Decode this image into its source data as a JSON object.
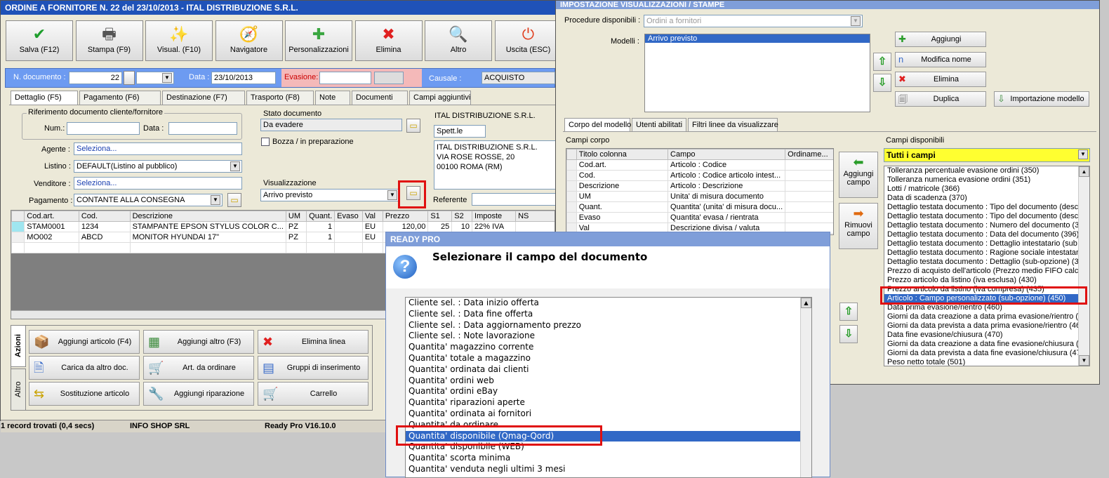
{
  "main_window": {
    "title": "ORDINE A FORNITORE N. 22 del 23/10/2013 - ITAL DISTRIBUZIONE S.R.L.",
    "toolbar": [
      {
        "label": "Salva (F12)",
        "icon": "check-icon",
        "glyph": "✔",
        "color": "#1e9e2c"
      },
      {
        "label": "Stampa (F9)",
        "icon": "printer-icon",
        "glyph": "🖶",
        "color": "#555555"
      },
      {
        "label": "Visual. (F10)",
        "icon": "magic-wand-icon",
        "glyph": "✨",
        "color": "#b88a00"
      },
      {
        "label": "Navigatore",
        "icon": "navigator-icon",
        "glyph": "🧭",
        "color": "#5560b0"
      },
      {
        "label": "Personalizzazioni",
        "icon": "puzzle-icon",
        "glyph": "✚",
        "color": "#3aa640"
      },
      {
        "label": "Elimina",
        "icon": "delete-x-icon",
        "glyph": "✖",
        "color": "#e02020"
      },
      {
        "label": "Altro",
        "icon": "magnifier-icon",
        "glyph": "🔍",
        "color": "#2b6bcb"
      },
      {
        "label": "Uscita (ESC)",
        "icon": "power-icon",
        "glyph": "⏻",
        "color": "#e04020"
      }
    ],
    "header": {
      "n_documento_label": "N. documento :",
      "n_documento": "22",
      "data_label": "Data :",
      "data": "23/10/2013",
      "evasione_label": "Evasione:",
      "evasione": "",
      "causale_label": "Causale :",
      "causale": "ACQUISTO"
    },
    "tabs": [
      "Dettaglio (F5)",
      "Pagamento (F6)",
      "Destinazione (F7)",
      "Trasporto (F8)",
      "Note",
      "Documenti",
      "Campi aggiuntivi"
    ],
    "rif": {
      "title": "Riferimento documento cliente/fornitore",
      "num_label": "Num.:",
      "data_label": "Data :"
    },
    "agente": {
      "label": "Agente :",
      "value": "Seleziona..."
    },
    "listino": {
      "label": "Listino :",
      "value": "DEFAULT(Listino al pubblico)"
    },
    "venditore": {
      "label": "Venditore :",
      "value": "Seleziona..."
    },
    "pagamento": {
      "label": "Pagamento :",
      "value": "CONTANTE ALLA CONSEGNA"
    },
    "stato": {
      "title": "Stato documento",
      "value": "Da evadere",
      "bozza": "Bozza / in preparazione"
    },
    "visualizzazione": {
      "title": "Visualizzazione",
      "value": "Arrivo previsto"
    },
    "fornitore": {
      "name": "ITAL DISTRIBUZIONE S.R.L.",
      "spett": "Spett.le",
      "address": [
        "ITAL DISTRIBUZIONE S.R.L.",
        "VIA ROSE ROSSE, 20",
        "00100 ROMA (RM)"
      ],
      "referente_label": "Referente"
    },
    "grid": {
      "columns": [
        "Cod.art.",
        "Cod.",
        "Descrizione",
        "UM",
        "Quant.",
        "Evaso",
        "Val",
        "Prezzo",
        "S1",
        "S2",
        "Imposte",
        "NS"
      ],
      "rows": [
        [
          "STAM0001",
          "1234",
          "STAMPANTE EPSON STYLUS COLOR C...",
          "PZ",
          "1",
          "",
          "EU",
          "120,00",
          "25",
          "10",
          "22% IVA",
          ""
        ],
        [
          "MO002",
          "ABCD",
          "MONITOR HYUNDAI 17\"",
          "PZ",
          "1",
          "",
          "EU",
          "",
          "",
          "",
          "",
          ""
        ]
      ]
    },
    "actions_tabs": [
      "Azioni",
      "Altro"
    ],
    "actions": [
      {
        "label": "Aggiungi articolo (F4)",
        "icon": "add-article-icon",
        "glyph": "📦"
      },
      {
        "label": "Aggiungi altro (F3)",
        "icon": "add-other-icon",
        "glyph": "▦"
      },
      {
        "label": "Elimina linea",
        "icon": "delete-line-icon",
        "glyph": "✖"
      },
      {
        "label": "Carica da altro doc.",
        "icon": "load-doc-icon",
        "glyph": "🗎"
      },
      {
        "label": "Art. da ordinare",
        "icon": "order-article-icon",
        "glyph": "🛒"
      },
      {
        "label": "Gruppi di inserimento",
        "icon": "groups-icon",
        "glyph": "▤"
      },
      {
        "label": "Sostituzione articolo",
        "icon": "replace-article-icon",
        "glyph": "⇆"
      },
      {
        "label": "Aggiungi riparazione",
        "icon": "wrench-icon",
        "glyph": "🔧"
      },
      {
        "label": "Carrello",
        "icon": "cart-icon",
        "glyph": "🛒"
      }
    ],
    "status_bar": {
      "records": "1 record trovati (0,4 secs)",
      "company": "INFO SHOP SRL",
      "version": "Ready Pro V16.10.0"
    }
  },
  "settings_window": {
    "title": "IMPOSTAZIONE VISUALIZZAZIONI / STAMPE",
    "procedure_label": "Procedure disponibili :",
    "procedure_value": "Ordini a fornitori",
    "modelli_label": "Modelli :",
    "modelli": [
      "Arrivo previsto"
    ],
    "buttons": [
      {
        "label": "Aggiungi",
        "icon": "plus-icon",
        "glyph": "✚"
      },
      {
        "label": "Modifica nome",
        "icon": "rename-icon",
        "glyph": "n"
      },
      {
        "label": "Elimina",
        "icon": "delete-icon",
        "glyph": "✖"
      },
      {
        "label": "Duplica",
        "icon": "duplicate-icon",
        "glyph": "🗐"
      },
      {
        "label": "Importazione modello",
        "icon": "import-icon",
        "glyph": "⇩"
      }
    ],
    "tabs": [
      "Corpo del modello",
      "Utenti abilitati",
      "Filtri linee da visualizzare"
    ],
    "campi_corpo_label": "Campi corpo",
    "corpo_columns": [
      "Titolo colonna",
      "Campo",
      "Ordiname..."
    ],
    "corpo_rows": [
      [
        "Cod.art.",
        "Articolo : Codice"
      ],
      [
        "Cod.",
        "Articolo : Codice articolo intest..."
      ],
      [
        "Descrizione",
        "Articolo : Descrizione"
      ],
      [
        "UM",
        "Unita' di misura documento"
      ],
      [
        "Quant.",
        "Quantita' (unita' di misura docu..."
      ],
      [
        "Evaso",
        "Quantita' evasa / rientrata"
      ],
      [
        "Val",
        "Descrizione divisa / valuta"
      ]
    ],
    "aggiungi_campo": "Aggiungi campo",
    "rimuovi_campo": "Rimuovi campo",
    "campi_disponibili_label": "Campi disponibili",
    "campi_filter": "Tutti i campi",
    "campi_list": [
      "Tolleranza percentuale evasione ordini (350)",
      "Tolleranza numerica evasione ordini (351)",
      "Lotti / matricole (366)",
      "Data di scadenza (370)",
      "Dettaglio testata documento : Tipo del documento (descr",
      "Dettaglio testata documento : Tipo del documento (descr",
      "Dettaglio testata documento : Numero del documento (39",
      "Dettaglio testata documento : Data del documento (396)",
      "Dettaglio testata documento : Dettaglio intestatario (sub",
      "Dettaglio testata documento : Ragione sociale intestatari",
      "Dettaglio testata documento : Dettaglio (sub-opzione) (3",
      "Prezzo di acquisto dell'articolo (Prezzo medio FIFO calcola",
      "Prezzo articolo da listino (iva esclusa) (430)",
      "Prezzo articolo da listino (iva compresa) (435)",
      "Articolo : Campo personalizzato (sub-opzione) (450)",
      "Data prima evasione/rientro (460)",
      "Giorni da data creazione a data prima evasione/rientro (4",
      "Giorni da data prevista a data prima evasione/rientro (46",
      "Data fine evasione/chiusura (470)",
      "Giorni da data creazione a data fine evasione/chiusura (4",
      "Giorni da data prevista a data fine evasione/chiusura (47",
      "Peso netto totale (501)"
    ],
    "campi_selected_index": 14
  },
  "popup": {
    "title": "READY PRO",
    "message": "Selezionare il campo del documento",
    "items": [
      "Cliente sel. : Data inizio offerta",
      "Cliente sel. : Data fine offerta",
      "Cliente sel. : Data aggiornamento prezzo",
      "Cliente sel. : Note lavorazione",
      "Quantita' magazzino corrente",
      "Quantita' totale a magazzino",
      "Quantita' ordinata dai clienti",
      "Quantita' ordini web",
      "Quantita' ordini eBay",
      "Quantita' riparazioni aperte",
      "Quantita' ordinata ai fornitori",
      "Quantita' da ordinare",
      "Quantita' disponibile (Qmag-Qord)",
      "Quantita' disponibile (WEB)",
      "Quantita' scorta minima",
      "Quantita' venduta negli ultimi 3 mesi"
    ],
    "selected_index": 12
  }
}
